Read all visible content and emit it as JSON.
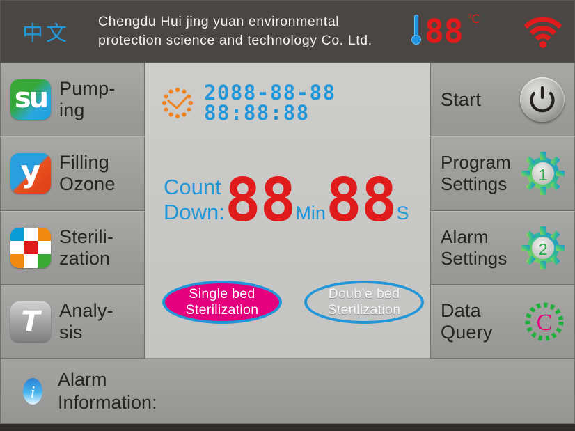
{
  "header": {
    "language_toggle": "中文",
    "company_name": "Chengdu Hui jing yuan environmental\nprotection science and technology Co. Ltd.",
    "temperature_value": "88",
    "temperature_unit": "℃",
    "thermometer_icon": "thermometer-icon",
    "wifi_icon": "wifi-icon",
    "colors": {
      "header_bg": "#4a4643",
      "lang_blue": "#2196d8",
      "led_red": "#e01b1b",
      "wifi_red": "#e01b1b"
    }
  },
  "left_menu": {
    "items": [
      {
        "label": "Pump-\ning",
        "icon": "stumbleupon-su-icon",
        "glyph": "su"
      },
      {
        "label": "Filling\nOzone",
        "icon": "letter-y-icon",
        "glyph": "y"
      },
      {
        "label": "Sterili-\nzation",
        "icon": "color-checkerboard-icon",
        "glyph": ""
      },
      {
        "label": "Analy-\nsis",
        "icon": "letter-t-icon",
        "glyph": "T"
      }
    ],
    "checker_colors": [
      "#0a9ad6",
      "#ffffff",
      "#f08a10",
      "#ffffff",
      "#e01b1b",
      "#ffffff",
      "#f08a10",
      "#ffffff",
      "#3aa935"
    ]
  },
  "center": {
    "clock_icon": "dotted-clock-icon",
    "datetime": "2088-88-88  88:88:88",
    "countdown_label": "Count\nDown:",
    "countdown_minutes": "88",
    "minutes_unit": "Min",
    "countdown_seconds": "88",
    "seconds_unit": "S",
    "bed_buttons": [
      {
        "label": "Single  bed\nSterilization",
        "state": "selected",
        "fill": "#e5007e",
        "border": "#2196d8"
      },
      {
        "label": "Double  bed\nSterilization",
        "state": "unselected",
        "fill": "transparent",
        "border": "#2196d8"
      }
    ]
  },
  "right_menu": {
    "items": [
      {
        "label": "Start",
        "icon": "power-button-icon",
        "badge": ""
      },
      {
        "label": "Program\nSettings",
        "icon": "gear-icon",
        "badge": "1"
      },
      {
        "label": "Alarm\nSettings",
        "icon": "gear-icon",
        "badge": "2"
      },
      {
        "label": "Data\nQuery",
        "icon": "data-query-c-icon",
        "badge": "C"
      }
    ]
  },
  "footer": {
    "info_icon": "info-i-icon",
    "alarm_label": "Alarm\nInformation:",
    "alarm_message": ""
  }
}
